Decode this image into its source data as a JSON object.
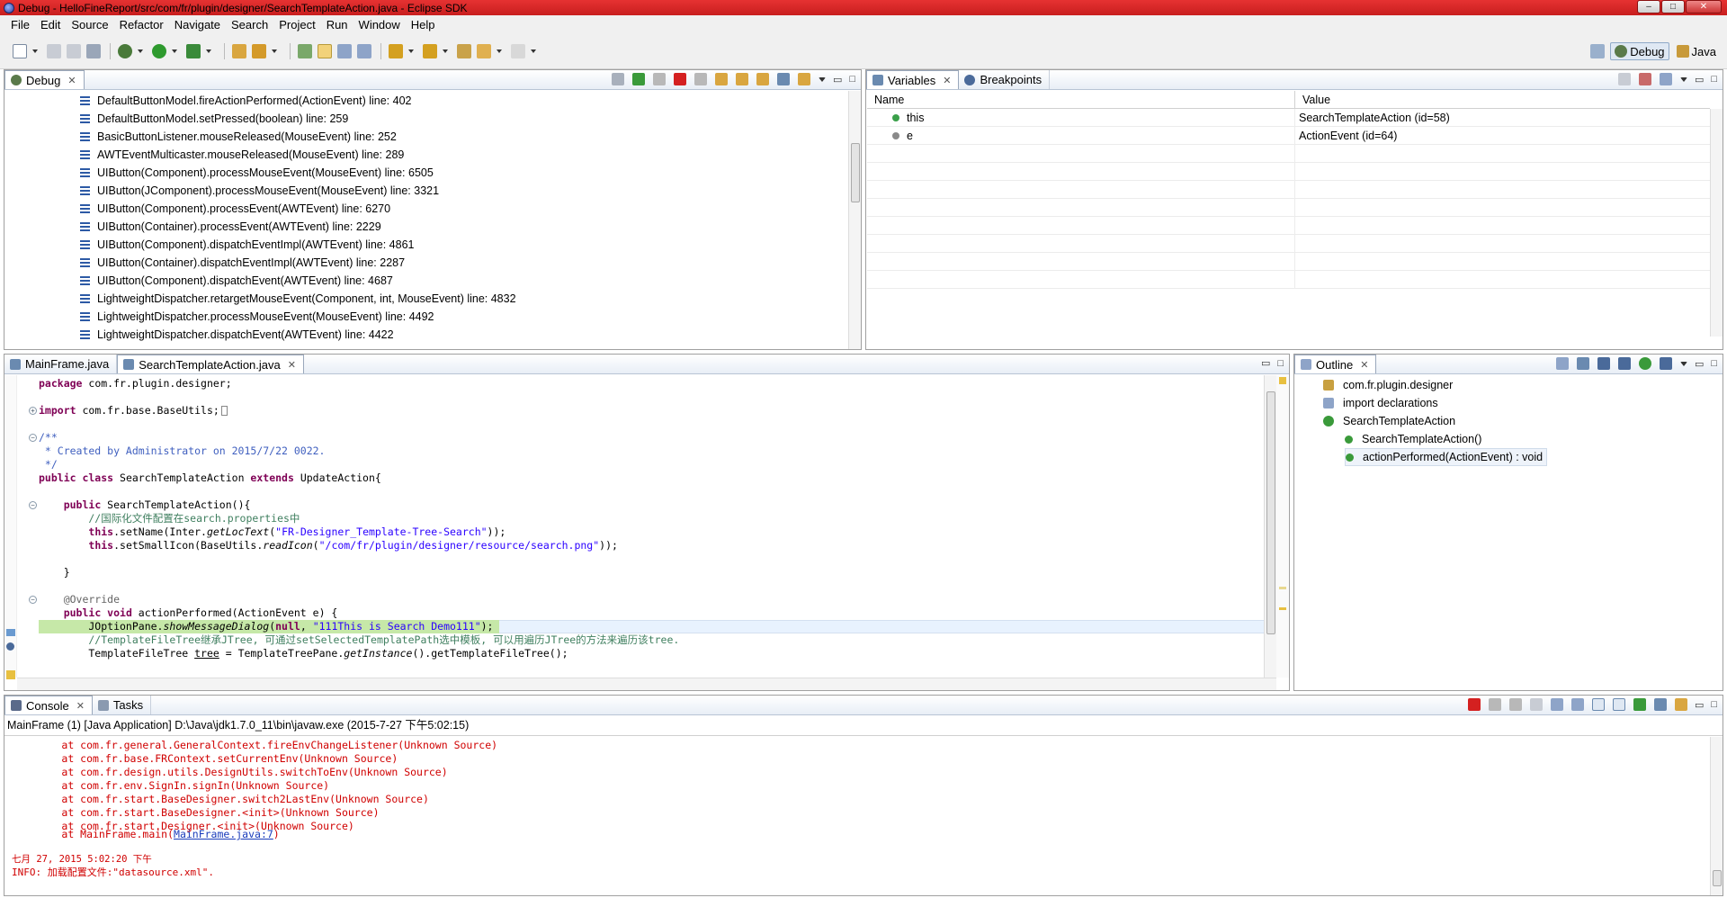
{
  "window": {
    "title": "Debug - HelloFineReport/src/com/fr/plugin/designer/SearchTemplateAction.java - Eclipse SDK",
    "minimize": "–",
    "maximize": "□",
    "close": "✕"
  },
  "menu": [
    "File",
    "Edit",
    "Source",
    "Refactor",
    "Navigate",
    "Search",
    "Project",
    "Run",
    "Window",
    "Help"
  ],
  "perspectives": {
    "debug": "Debug",
    "java": "Java"
  },
  "debug_view": {
    "tab": "Debug",
    "frames": [
      "DefaultButtonModel.fireActionPerformed(ActionEvent) line: 402",
      "DefaultButtonModel.setPressed(boolean) line: 259",
      "BasicButtonListener.mouseReleased(MouseEvent) line: 252",
      "AWTEventMulticaster.mouseReleased(MouseEvent) line: 289",
      "UIButton(Component).processMouseEvent(MouseEvent) line: 6505",
      "UIButton(JComponent).processMouseEvent(MouseEvent) line: 3321",
      "UIButton(Component).processEvent(AWTEvent) line: 6270",
      "UIButton(Container).processEvent(AWTEvent) line: 2229",
      "UIButton(Component).dispatchEventImpl(AWTEvent) line: 4861",
      "UIButton(Container).dispatchEventImpl(AWTEvent) line: 2287",
      "UIButton(Component).dispatchEvent(AWTEvent) line: 4687",
      "LightweightDispatcher.retargetMouseEvent(Component, int, MouseEvent) line: 4832",
      "LightweightDispatcher.processMouseEvent(MouseEvent) line: 4492",
      "LightweightDispatcher.dispatchEvent(AWTEvent) line: 4422"
    ]
  },
  "variables_view": {
    "tabs": [
      "Variables",
      "Breakpoints"
    ],
    "columns": [
      "Name",
      "Value"
    ],
    "rows": [
      {
        "name": "this",
        "value": "SearchTemplateAction  (id=58)",
        "dot": "#3aa04a"
      },
      {
        "name": "e",
        "value": "ActionEvent  (id=64)",
        "dot": "#8a8a8a"
      }
    ]
  },
  "editor": {
    "tabs": [
      "MainFrame.java",
      "SearchTemplateAction.java"
    ],
    "active_tab": 1
  },
  "outline_view": {
    "tab": "Outline",
    "items": [
      {
        "label": "com.fr.plugin.designer",
        "indent": 0,
        "icon": "package-icon"
      },
      {
        "label": "import declarations",
        "indent": 0,
        "icon": "imports-icon"
      },
      {
        "label": "SearchTemplateAction",
        "indent": 0,
        "icon": "class-icon"
      },
      {
        "label": "SearchTemplateAction()",
        "indent": 1,
        "icon": "constructor-icon"
      },
      {
        "label": "actionPerformed(ActionEvent) : void",
        "indent": 1,
        "icon": "method-icon",
        "selected": true
      }
    ]
  },
  "console_view": {
    "tabs": [
      "Console",
      "Tasks"
    ],
    "launch": "MainFrame (1) [Java Application] D:\\Java\\jdk1.7.0_11\\bin\\javaw.exe (2015-7-27 下午5:02:15)",
    "lines": [
      "\tat com.fr.general.GeneralContext.fireEnvChangeListener(Unknown Source)",
      "\tat com.fr.base.FRContext.setCurrentEnv(Unknown Source)",
      "\tat com.fr.design.utils.DesignUtils.switchToEnv(Unknown Source)",
      "\tat com.fr.env.SignIn.signIn(Unknown Source)",
      "\tat com.fr.start.BaseDesigner.switch2LastEnv(Unknown Source)",
      "\tat com.fr.start.BaseDesigner.<init>(Unknown Source)",
      "\tat com.fr.start.Designer.<init>(Unknown Source)"
    ],
    "main_prefix": "\tat MainFrame.main(",
    "main_link": "MainFrame.java:7",
    "main_suffix": ")",
    "timestamp": "七月 27, 2015 5:02:20 下午",
    "info": "INFO: 加载配置文件:\"datasource.xml\"."
  }
}
